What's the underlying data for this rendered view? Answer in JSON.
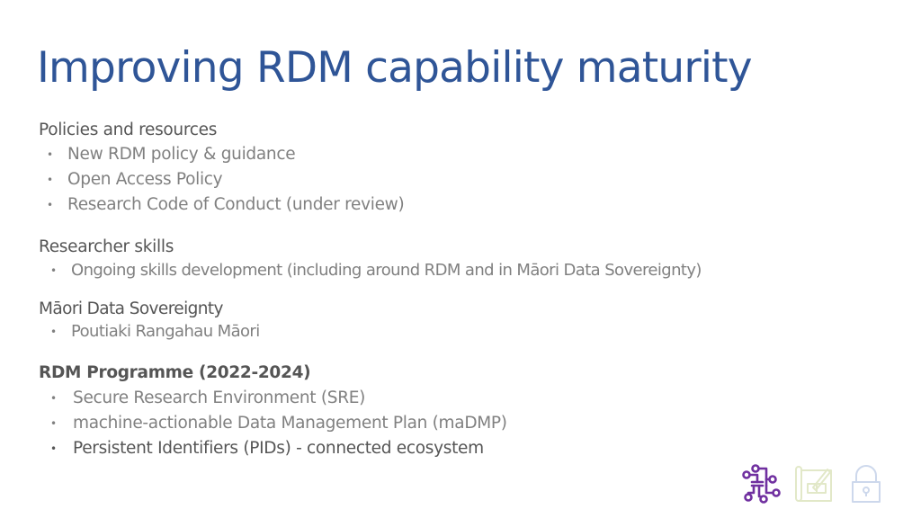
{
  "slide": {
    "title": "Improving RDM capability maturity",
    "sections": [
      {
        "heading": "Policies and resources",
        "items": [
          "New RDM policy & guidance",
          "Open Access Policy",
          "Research Code of Conduct (under review)"
        ]
      },
      {
        "heading": "Researcher skills",
        "items": [
          "Ongoing skills development (including around RDM and in Māori Data Sovereignty)"
        ]
      },
      {
        "heading": "Māori Data Sovereignty",
        "items": [
          "Poutiaki Rangahau Māori"
        ]
      },
      {
        "heading": "RDM Programme (2022-2024)",
        "items": [
          "Secure Research Environment (SRE)",
          "machine-actionable Data Management Plan (maDMP)",
          "Persistent Identifiers (PIDs) - connected ecosystem"
        ]
      }
    ],
    "bullet": "•",
    "icons": [
      {
        "name": "network-icon",
        "color": "#7030a0"
      },
      {
        "name": "blueprint-icon",
        "color": "#e2e8c8"
      },
      {
        "name": "padlock-icon",
        "color": "#cdd8ec"
      }
    ],
    "colors": {
      "title": "#2f5597",
      "heading": "#555555",
      "item": "#808080"
    }
  }
}
